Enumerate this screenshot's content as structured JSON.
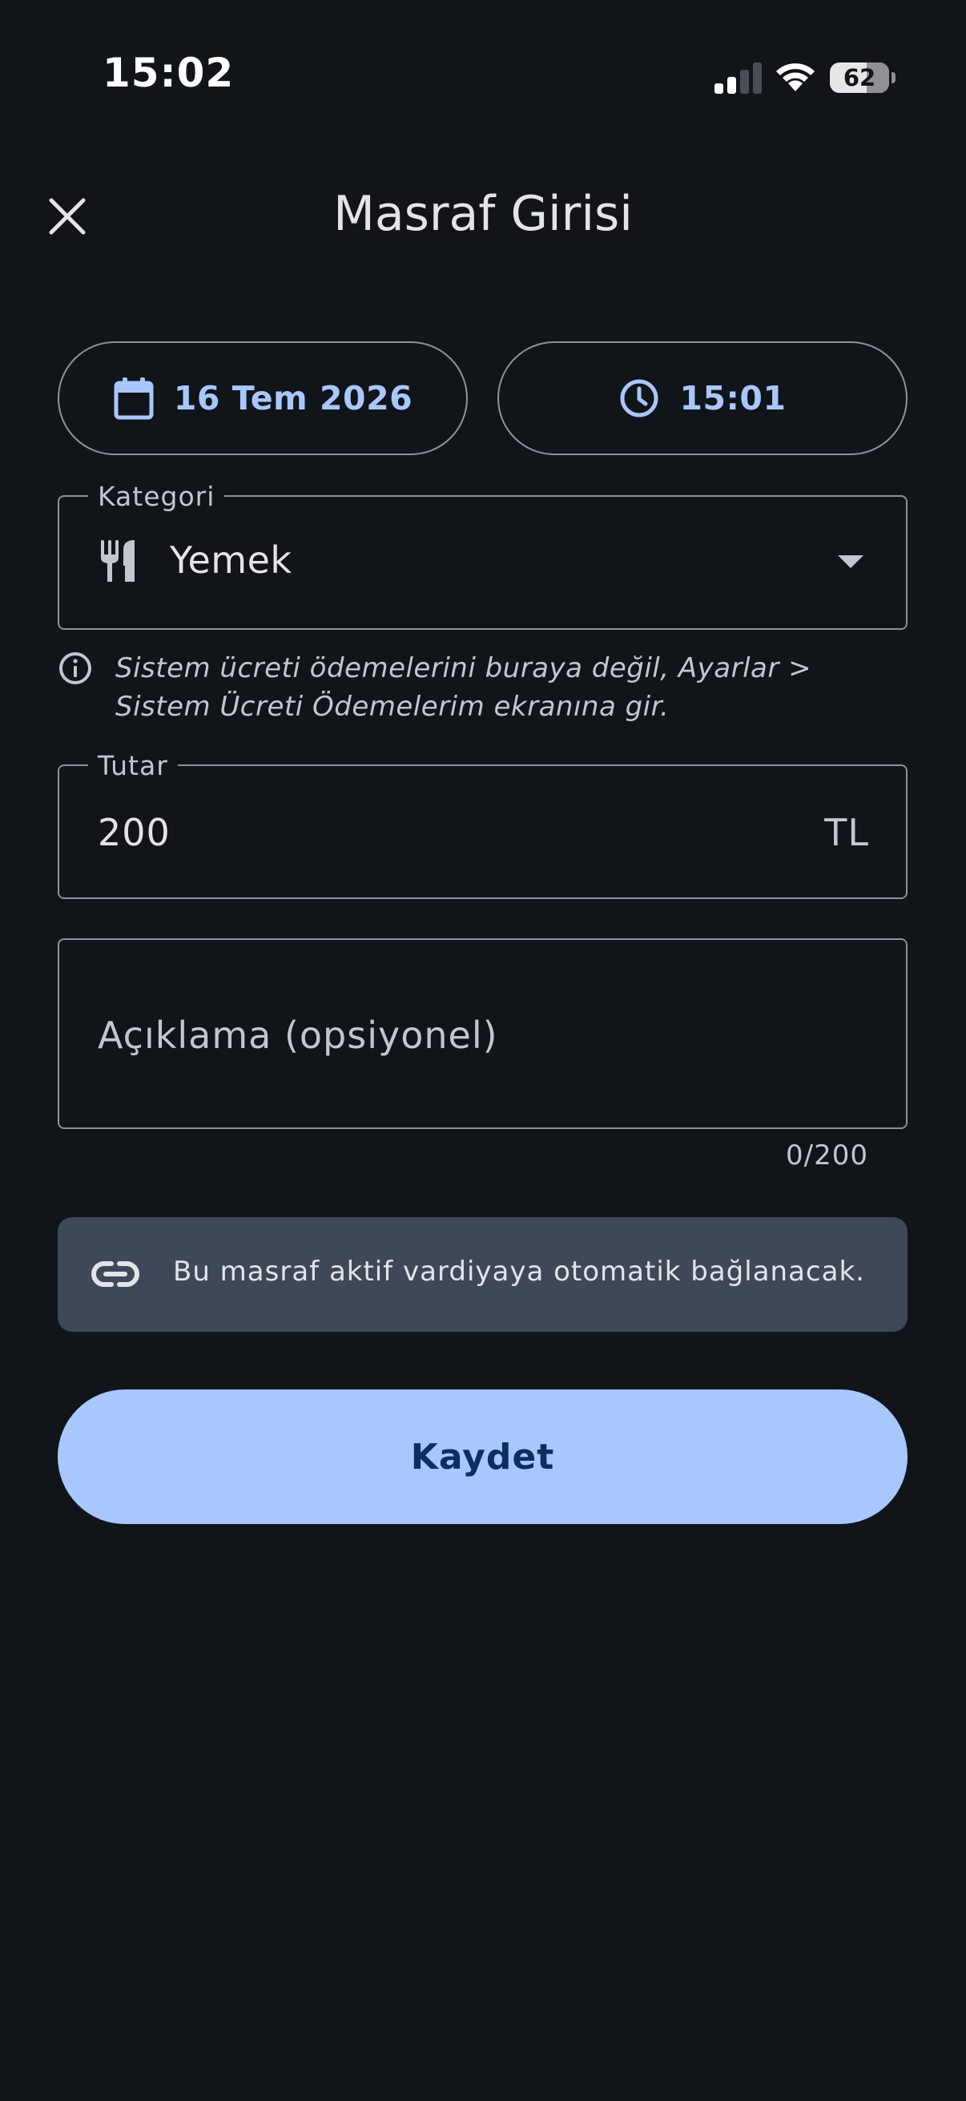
{
  "status_bar": {
    "time": "15:02",
    "battery_level": "62",
    "battery_fraction": 0.62
  },
  "header": {
    "title": "Masraf Girisi",
    "close_icon": "close-icon"
  },
  "date_button": {
    "label": "16 Tem 2026",
    "icon": "calendar-icon"
  },
  "time_button": {
    "label": "15:01",
    "icon": "clock-icon"
  },
  "category": {
    "label": "Kategori",
    "value": "Yemek",
    "icon": "fork-knife-icon"
  },
  "hint": {
    "text": "Sistem ücreti ödemelerini buraya değil, Ayarlar > Sistem Ücreti Ödemelerim ekranına gir."
  },
  "amount": {
    "label": "Tutar",
    "value": "200",
    "suffix": "TL"
  },
  "description": {
    "placeholder": "Açıklama (opsiyonel)",
    "counter": "0/200"
  },
  "banner": {
    "text": "Bu masraf aktif vardiyaya otomatik bağlanacak.",
    "icon": "link-icon"
  },
  "save_button": {
    "label": "Kaydet"
  },
  "colors": {
    "background": "#111419",
    "accent": "#a9c7ff",
    "banner": "#3e4858",
    "outline": "#8e9199"
  }
}
